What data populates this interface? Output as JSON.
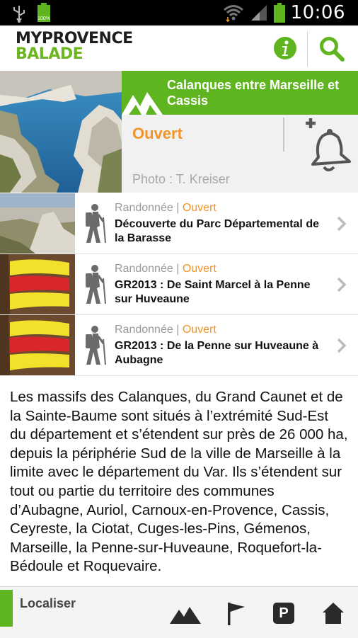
{
  "status_bar": {
    "time": "10:06",
    "battery_text": "100%"
  },
  "header": {
    "logo_line1": "MYPROVENCE",
    "logo_line2": "BALADE"
  },
  "hero": {
    "title": "Calanques entre Marseille et Cassis",
    "status": "Ouvert",
    "credit": "Photo : T. Kreiser"
  },
  "rows": [
    {
      "category": "Randonnée",
      "separator": "|",
      "status": "Ouvert",
      "title": "Découverte du Parc Départemental de la Barasse"
    },
    {
      "category": "Randonnée",
      "separator": "|",
      "status": "Ouvert",
      "title": "GR2013 : De Saint Marcel à la Penne sur Huveaune"
    },
    {
      "category": "Randonnée",
      "separator": "|",
      "status": "Ouvert",
      "title": "GR2013 : De la Penne sur Huveaune à Aubagne"
    }
  ],
  "description": "Les massifs des Calanques, du Grand Caunet et de la Sainte-Baume sont situés à l’extrémité Sud-Est du département et s’étendent sur près de 26 000 ha, depuis la périphérie Sud de la ville de Marseille à la limite avec le département du Var. Ils s’étendent sur tout ou partie du territoire des communes d’Aubagne, Auriol, Carnoux-en-Provence, Cassis, Ceyreste, la Ciotat, Cuges-les-Pins, Gémenos, Marseille, la Penne-sur-Huveaune, Roquefort-la-Bédoule et Roquevaire.",
  "bottom_bar": {
    "label": "Localiser",
    "parking_glyph": "P"
  },
  "colors": {
    "brand_green": "#5fb51f",
    "status_orange": "#f39428"
  },
  "icons": [
    "usb-icon",
    "wifi-icon",
    "signal-icon",
    "battery-icon",
    "info-icon",
    "search-icon",
    "add-alert-bell-icon",
    "hiker-icon",
    "chevron-right-icon",
    "mountains-icon",
    "flag-icon",
    "parking-icon",
    "home-icon"
  ]
}
